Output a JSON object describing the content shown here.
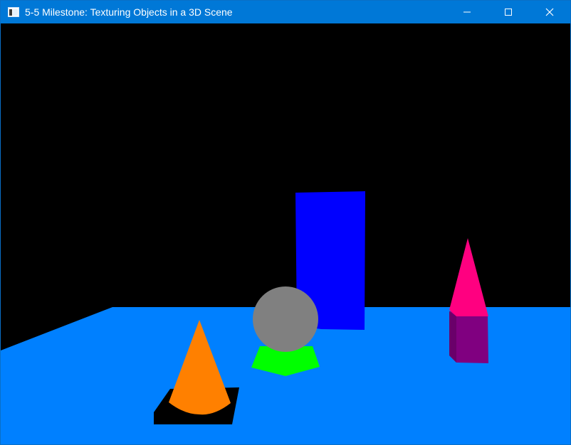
{
  "window": {
    "title": "5-5 Milestone: Texturing Objects in a 3D Scene",
    "app_icon": "window-app-icon",
    "controls": [
      {
        "name": "minimize-button",
        "icon": "minimize-icon"
      },
      {
        "name": "maximize-button",
        "icon": "maximize-icon"
      },
      {
        "name": "close-button",
        "icon": "close-icon"
      }
    ]
  },
  "scene": {
    "background_color": "#000000",
    "objects": [
      {
        "name": "ground-plane",
        "shape": "plane",
        "color": "#0080ff"
      },
      {
        "name": "tall-box",
        "shape": "box",
        "color": "#0000ff"
      },
      {
        "name": "sphere",
        "shape": "sphere",
        "color": "#808080"
      },
      {
        "name": "sphere-base",
        "shape": "pentagonal prism",
        "color": "#00ff00"
      },
      {
        "name": "cone",
        "shape": "cone",
        "color": "#ff8000"
      },
      {
        "name": "cone-base",
        "shape": "square slab",
        "color": "#000000"
      },
      {
        "name": "pyramid-top",
        "shape": "pyramid",
        "color": "#ff0080"
      },
      {
        "name": "small-box",
        "shape": "box",
        "color": "#800080"
      }
    ]
  }
}
